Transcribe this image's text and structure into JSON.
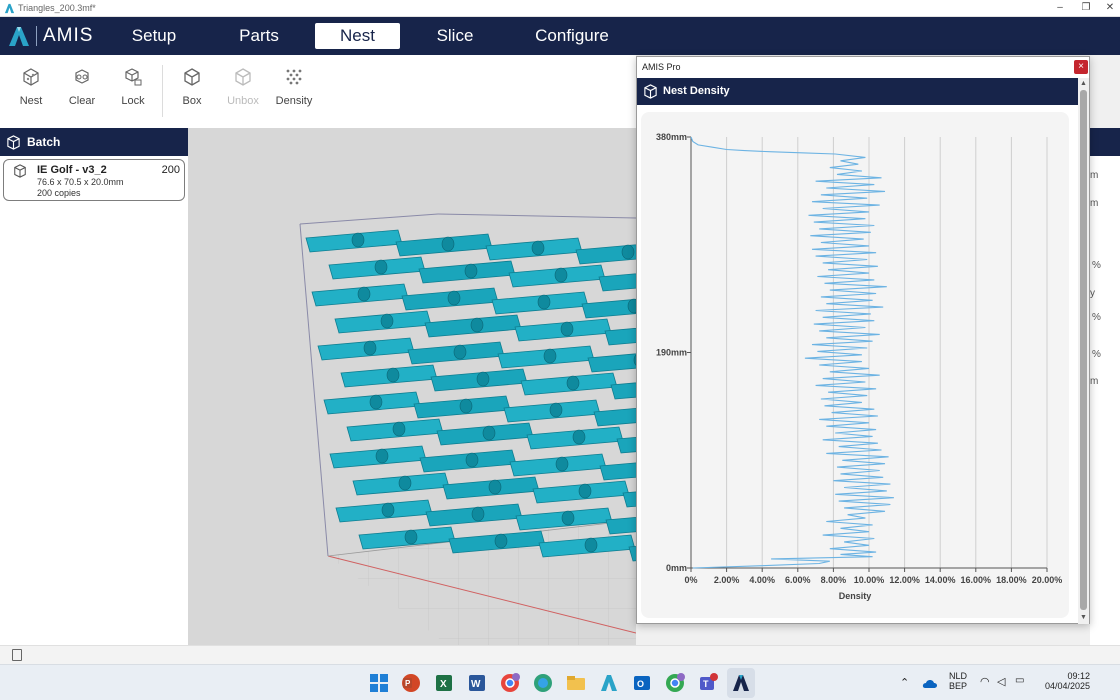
{
  "window": {
    "title": "Triangles_200.3mf*",
    "controls": [
      "–",
      "❐",
      "✕"
    ]
  },
  "nav": {
    "logo_text": "AMIS",
    "tabs": [
      {
        "label": "Setup",
        "active": false
      },
      {
        "label": "Parts",
        "active": false
      },
      {
        "label": "Nest",
        "active": true
      },
      {
        "label": "Slice",
        "active": false
      },
      {
        "label": "Configure",
        "active": false
      }
    ]
  },
  "toolbar": {
    "nest_label": "Nest",
    "clear_label": "Clear",
    "lock_label": "Lock",
    "box_label": "Box",
    "unbox_label": "Unbox",
    "density_label": "Density"
  },
  "batch": {
    "header": "Batch",
    "items": [
      {
        "name": "IE Golf - v3_2",
        "count": "200",
        "dims": "76.6 x 70.5 x 20.0mm",
        "copies": "200 copies"
      }
    ]
  },
  "right_panel": {
    "fragments": [
      "m",
      "m",
      "%",
      "y",
      "%",
      "%",
      "m"
    ]
  },
  "dialog": {
    "title": "AMIS Pro",
    "close_label": "×",
    "header": "Nest Density"
  },
  "chart_data": {
    "type": "line",
    "title": "",
    "xlabel": "Density",
    "ylabel": "",
    "xlim": [
      0,
      20
    ],
    "ylim": [
      0,
      380
    ],
    "x_ticks": [
      "0%",
      "2.00%",
      "4.00%",
      "6.00%",
      "8.00%",
      "10.00%",
      "12.00%",
      "14.00%",
      "16.00%",
      "18.00%",
      "20.00%"
    ],
    "y_ticks": [
      "0mm",
      "190mm",
      "380mm"
    ],
    "y_tick_values": [
      0,
      190,
      380
    ],
    "grid": "vertical",
    "series": [
      {
        "color": "#6cb3e3",
        "points": [
          [
            0.1,
            0
          ],
          [
            4.0,
            2
          ],
          [
            7.2,
            4
          ],
          [
            7.8,
            6
          ],
          [
            4.5,
            8
          ],
          [
            10.2,
            10
          ],
          [
            8.4,
            12
          ],
          [
            10.4,
            14
          ],
          [
            7.8,
            17
          ],
          [
            10.0,
            20
          ],
          [
            8.6,
            23
          ],
          [
            10.3,
            26
          ],
          [
            7.4,
            29
          ],
          [
            10.0,
            32
          ],
          [
            8.4,
            35
          ],
          [
            10.2,
            38
          ],
          [
            7.6,
            41
          ],
          [
            9.8,
            44
          ],
          [
            8.8,
            47
          ],
          [
            10.9,
            50
          ],
          [
            8.6,
            53
          ],
          [
            11.2,
            56
          ],
          [
            8.3,
            59
          ],
          [
            11.4,
            62
          ],
          [
            8.1,
            65
          ],
          [
            11.0,
            68
          ],
          [
            8.6,
            71
          ],
          [
            11.2,
            74
          ],
          [
            8.0,
            77
          ],
          [
            10.8,
            80
          ],
          [
            8.4,
            83
          ],
          [
            10.6,
            86
          ],
          [
            8.2,
            89
          ],
          [
            10.9,
            92
          ],
          [
            8.5,
            95
          ],
          [
            11.1,
            98
          ],
          [
            7.6,
            101
          ],
          [
            10.7,
            104
          ],
          [
            8.3,
            107
          ],
          [
            10.5,
            110
          ],
          [
            7.4,
            113
          ],
          [
            10.2,
            116
          ],
          [
            8.1,
            119
          ],
          [
            10.4,
            122
          ],
          [
            7.6,
            125
          ],
          [
            10.0,
            128
          ],
          [
            7.2,
            131
          ],
          [
            10.5,
            134
          ],
          [
            7.9,
            137
          ],
          [
            10.3,
            140
          ],
          [
            7.5,
            143
          ],
          [
            9.6,
            146
          ],
          [
            7.3,
            149
          ],
          [
            9.9,
            152
          ],
          [
            7.7,
            155
          ],
          [
            10.4,
            158
          ],
          [
            7.0,
            161
          ],
          [
            9.8,
            164
          ],
          [
            7.4,
            167
          ],
          [
            10.6,
            170
          ],
          [
            7.8,
            173
          ],
          [
            10.0,
            176
          ],
          [
            7.2,
            179
          ],
          [
            9.6,
            182
          ],
          [
            6.4,
            185
          ],
          [
            9.6,
            188
          ],
          [
            7.1,
            191
          ],
          [
            9.9,
            194
          ],
          [
            6.8,
            197
          ],
          [
            10.2,
            200
          ],
          [
            7.6,
            203
          ],
          [
            10.6,
            206
          ],
          [
            7.2,
            209
          ],
          [
            9.8,
            212
          ],
          [
            6.9,
            215
          ],
          [
            10.3,
            218
          ],
          [
            7.4,
            221
          ],
          [
            10.1,
            224
          ],
          [
            7.0,
            227
          ],
          [
            10.8,
            230
          ],
          [
            7.6,
            233
          ],
          [
            10.2,
            236
          ],
          [
            7.3,
            239
          ],
          [
            10.4,
            242
          ],
          [
            7.8,
            245
          ],
          [
            11.0,
            248
          ],
          [
            7.5,
            251
          ],
          [
            10.3,
            254
          ],
          [
            7.1,
            257
          ],
          [
            10.0,
            260
          ],
          [
            7.7,
            263
          ],
          [
            10.5,
            266
          ],
          [
            7.4,
            269
          ],
          [
            9.9,
            272
          ],
          [
            7.0,
            275
          ],
          [
            10.4,
            278
          ],
          [
            6.8,
            281
          ],
          [
            10.0,
            284
          ],
          [
            7.3,
            287
          ],
          [
            9.7,
            290
          ],
          [
            6.7,
            293
          ],
          [
            10.1,
            296
          ],
          [
            7.2,
            299
          ],
          [
            10.3,
            302
          ],
          [
            6.9,
            305
          ],
          [
            9.8,
            308
          ],
          [
            6.6,
            311
          ],
          [
            10.0,
            314
          ],
          [
            7.4,
            317
          ],
          [
            10.6,
            320
          ],
          [
            6.8,
            323
          ],
          [
            9.9,
            326
          ],
          [
            7.3,
            329
          ],
          [
            10.9,
            332
          ],
          [
            7.6,
            335
          ],
          [
            10.3,
            338
          ],
          [
            7.0,
            341
          ],
          [
            10.7,
            344
          ],
          [
            8.2,
            347
          ],
          [
            9.6,
            350
          ],
          [
            7.8,
            353
          ],
          [
            9.4,
            356
          ],
          [
            8.4,
            359
          ],
          [
            9.8,
            362
          ],
          [
            8.1,
            365
          ],
          [
            6.4,
            366
          ],
          [
            4.4,
            367
          ],
          [
            3.0,
            368
          ],
          [
            2.0,
            369
          ],
          [
            1.2,
            371
          ],
          [
            0.4,
            373
          ],
          [
            0.1,
            376
          ],
          [
            0.0,
            380
          ]
        ]
      }
    ]
  }
}
